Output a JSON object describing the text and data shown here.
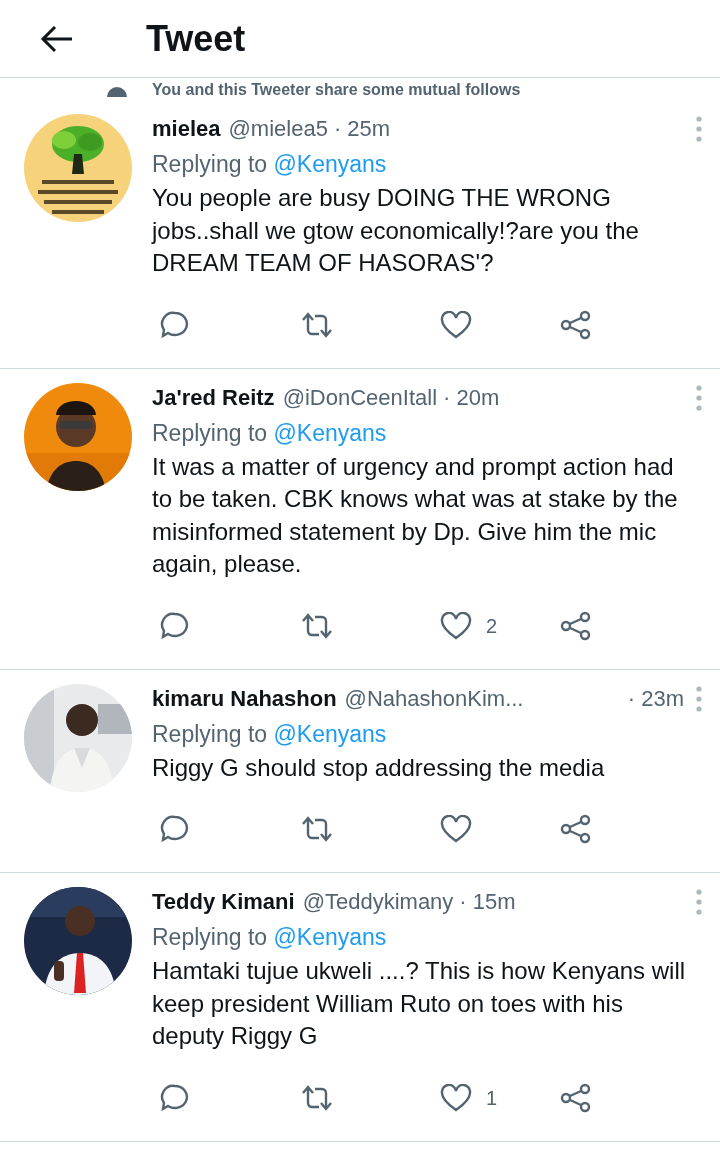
{
  "header": {
    "title": "Tweet"
  },
  "notice": {
    "text": "You and this Tweeter share some mutual follows"
  },
  "tweets": [
    {
      "name": "mielea",
      "handle": "@mielea5",
      "time": "· 25m",
      "replying_to": "Replying to",
      "replying_handle": "@Kenyans",
      "text": "You people are busy DOING THE WRONG jobs..shall we gtow economically!?are you the DREAM TEAM OF HASORAS'?"
    },
    {
      "name": "Ja'red Reitz",
      "handle": "@iDonCeenItall",
      "time": "· 20m",
      "replying_to": "Replying to",
      "replying_handle": "@Kenyans",
      "text": "It was a matter of urgency and prompt action had to be taken. CBK knows what was at stake by the misinformed statement by Dp. Give him the mic again, please.",
      "likes": "2"
    },
    {
      "name": "kimaru Nahashon",
      "handle": "@NahashonKim...",
      "time": "· 23m",
      "replying_to": "Replying to",
      "replying_handle": "@Kenyans",
      "text": "Riggy G should stop addressing the media"
    },
    {
      "name": "Teddy Kimani",
      "handle": "@Teddykimany",
      "time": "· 15m",
      "replying_to": "Replying to",
      "replying_handle": "@Kenyans",
      "text": "Hamtaki tujue ukweli ....? This is how Kenyans will keep president William Ruto on toes with his deputy Riggy G",
      "likes": "1"
    }
  ]
}
